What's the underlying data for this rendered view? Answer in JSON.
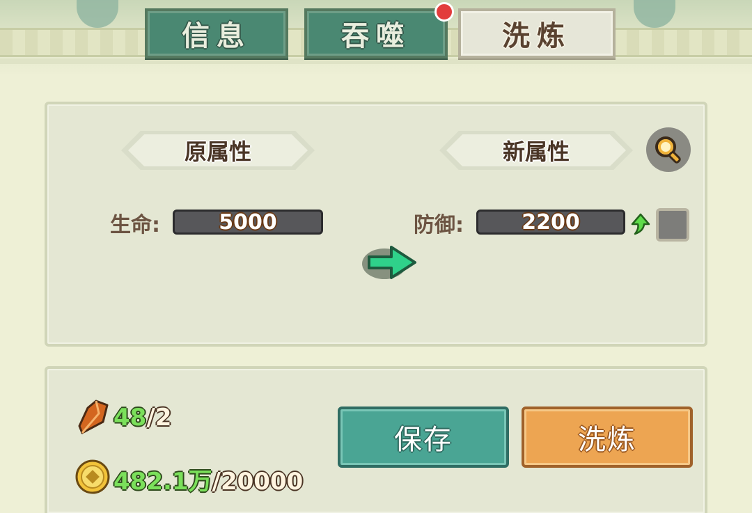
{
  "tabs": [
    {
      "label": "信息",
      "active": false
    },
    {
      "label": "吞噬",
      "active": false,
      "has_notification": true
    },
    {
      "label": "洗炼",
      "active": true
    }
  ],
  "compare": {
    "original_header": "原属性",
    "new_header": "新属性",
    "original": {
      "label": "生命:",
      "value": "5000"
    },
    "new": {
      "label": "防御:",
      "value": "2200",
      "trend": "up",
      "locked": false
    }
  },
  "resources": {
    "crystal": {
      "have": "48",
      "sep": "/",
      "need": "2"
    },
    "coin": {
      "have": "482.1万",
      "sep": "/",
      "need": "20000"
    }
  },
  "buttons": {
    "save": "保存",
    "refine": "洗炼"
  },
  "colors": {
    "tab_green": "#4a8872",
    "save_button": "#4aa594",
    "refine_button": "#eda552",
    "resource_green": "#7be05b"
  }
}
